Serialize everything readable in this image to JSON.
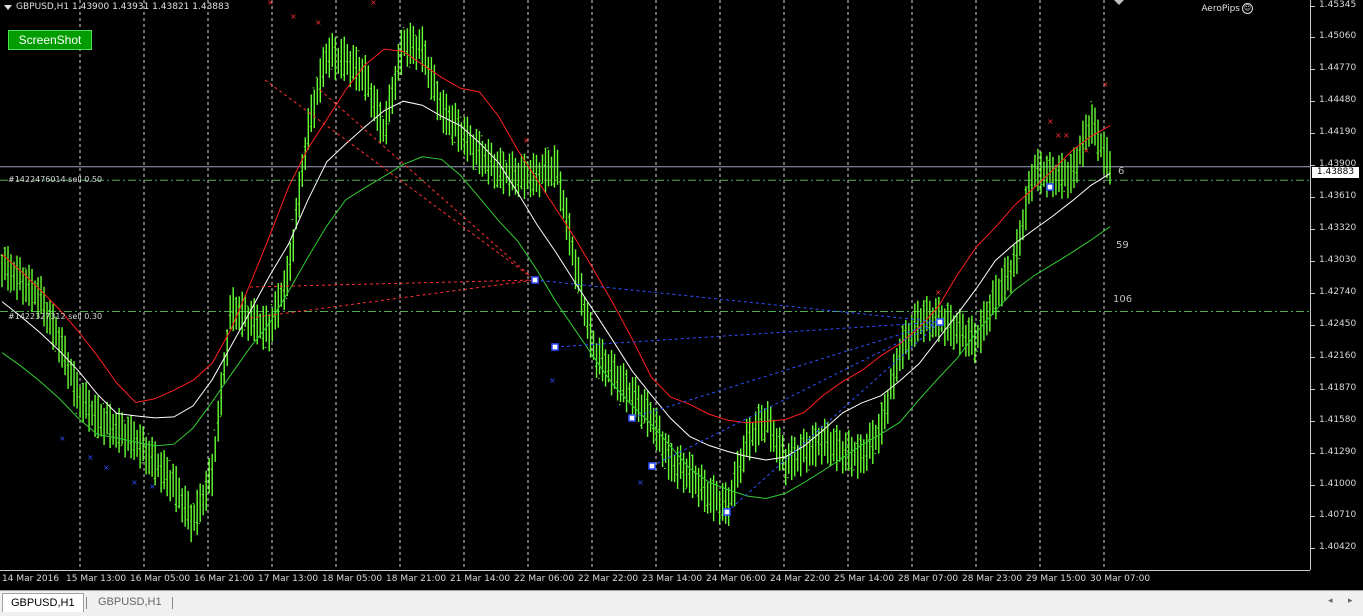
{
  "header": {
    "symbol_info": "GBPUSD,H1  1.43900 1.43931 1.43821 1.43883"
  },
  "screenshot_button": "ScreenShot",
  "brand": "AeroPips",
  "orders": [
    {
      "label": "#1422476014 sell 0.50",
      "price": 1.4376
    },
    {
      "label": "#1422327312 sell 0.30",
      "price": 1.4257
    }
  ],
  "current_price": {
    "label": "1.43883",
    "value": 1.43883
  },
  "price_axis": {
    "min": 1.4027,
    "max": 1.4535,
    "labels": [
      "1.45345",
      "1.45060",
      "1.44770",
      "1.44480",
      "1.44190",
      "1.43900",
      "1.43610",
      "1.43320",
      "1.43030",
      "1.42740",
      "1.42450",
      "1.42160",
      "1.41870",
      "1.41580",
      "1.41290",
      "1.41000",
      "1.40710",
      "1.40420"
    ],
    "values": [
      1.45345,
      1.4506,
      1.4477,
      1.4448,
      1.4419,
      1.439,
      1.4361,
      1.4332,
      1.4303,
      1.4274,
      1.4245,
      1.4216,
      1.4187,
      1.4158,
      1.4129,
      1.41,
      1.4071,
      1.4042
    ]
  },
  "time_axis": {
    "labels": [
      "14 Mar 2016",
      "15 Mar 13:00",
      "16 Mar 05:00",
      "16 Mar 21:00",
      "17 Mar 13:00",
      "18 Mar 05:00",
      "18 Mar 21:00",
      "21 Mar 14:00",
      "22 Mar 06:00",
      "22 Mar 22:00",
      "23 Mar 14:00",
      "24 Mar 06:00",
      "24 Mar 22:00",
      "25 Mar 14:00",
      "28 Mar 07:00",
      "28 Mar 23:00",
      "29 Mar 15:00",
      "30 Mar 07:00"
    ]
  },
  "ma_labels": [
    "6",
    "59",
    "106"
  ],
  "chart_data": {
    "type": "line",
    "title": "",
    "series": [
      {
        "name": "GBPUSD,H1",
        "values": [
          1.43,
          1.4285,
          1.427,
          1.423,
          1.418,
          1.416,
          1.415,
          1.414,
          1.412,
          1.41,
          1.4065,
          1.411,
          1.426,
          1.425,
          1.424,
          1.429,
          1.442,
          1.449,
          1.4485,
          1.447,
          1.442,
          1.45,
          1.4495,
          1.444,
          1.442,
          1.44,
          1.4385,
          1.438,
          1.438,
          1.439,
          1.43,
          1.422,
          1.42,
          1.418,
          1.416,
          1.412,
          1.411,
          1.409,
          1.408,
          1.414,
          1.416,
          1.412,
          1.413,
          1.414,
          1.413,
          1.4125,
          1.415,
          1.422,
          1.425,
          1.425,
          1.424,
          1.423,
          1.427,
          1.43,
          1.4385,
          1.438,
          1.438,
          1.443,
          1.4388
        ]
      }
    ],
    "ylim": [
      1.4027,
      1.4535
    ],
    "grid": true,
    "tick_labels_y": [
      "1.45345",
      "1.45060",
      "1.44770",
      "1.44480",
      "1.44190",
      "1.43900",
      "1.43610",
      "1.43320",
      "1.43030",
      "1.42740",
      "1.42450",
      "1.42160",
      "1.41870",
      "1.41580",
      "1.41290",
      "1.41000",
      "1.40710",
      "1.40420"
    ],
    "tick_labels_x": [
      "14 Mar 2016",
      "15 Mar 13:00",
      "16 Mar 05:00",
      "16 Mar 21:00",
      "17 Mar 13:00",
      "18 Mar 05:00",
      "18 Mar 21:00",
      "21 Mar 14:00",
      "22 Mar 06:00",
      "22 Mar 22:00",
      "23 Mar 14:00",
      "24 Mar 06:00",
      "24 Mar 22:00",
      "25 Mar 14:00",
      "28 Mar 07:00",
      "28 Mar 23:00",
      "29 Mar 15:00",
      "30 Mar 07:00"
    ]
  },
  "tabs": [
    {
      "label": "GBPUSD,H1",
      "active": true
    },
    {
      "label": "GBPUSD,H1",
      "active": false
    }
  ],
  "colors": {
    "bars": "#66ff33",
    "ma_fast": "#ff2020",
    "ma_mid": "#ffffff",
    "ma_slow": "#33cc33",
    "order_line": "#55aa55",
    "button": "#009c00"
  }
}
